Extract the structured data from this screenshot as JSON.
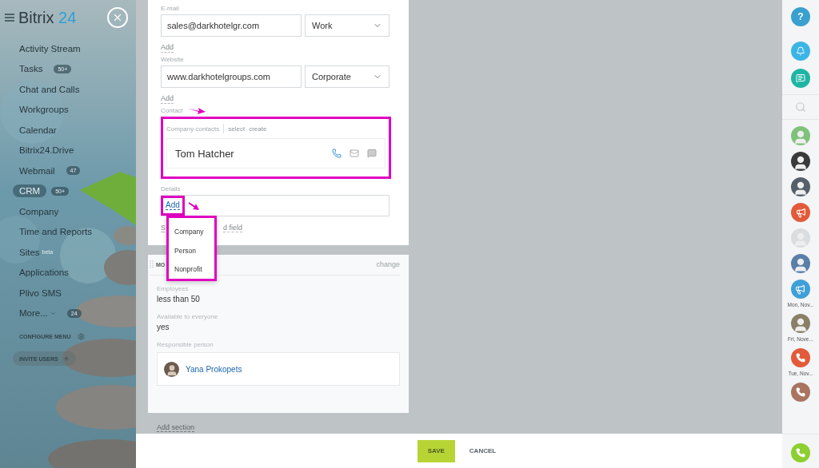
{
  "sidebar": {
    "logo": {
      "name": "Bitrix",
      "number": "24"
    },
    "items": [
      {
        "label": "Activity Stream",
        "selected": false
      },
      {
        "label": "Tasks",
        "badge": "50+",
        "selected": false
      },
      {
        "label": "Chat and Calls",
        "selected": false
      },
      {
        "label": "Workgroups",
        "selected": false
      },
      {
        "label": "Calendar",
        "selected": false
      },
      {
        "label": "Bitrix24.Drive",
        "selected": false
      },
      {
        "label": "Webmail",
        "badge": "47",
        "selected": false
      },
      {
        "label": "CRM",
        "badge": "50+",
        "selected": true
      },
      {
        "label": "Company",
        "selected": false
      },
      {
        "label": "Time and Reports",
        "selected": false
      },
      {
        "label": "Sites",
        "superscript": "beta",
        "selected": false
      },
      {
        "label": "Applications",
        "selected": false
      },
      {
        "label": "Plivo SMS",
        "selected": false
      },
      {
        "label": "More...",
        "badge": "24",
        "dropdown": true,
        "selected": false
      }
    ],
    "configure_menu": "CONFIGURE MENU",
    "invite_users": "INVITE USERS"
  },
  "form": {
    "email": {
      "label": "E-mail",
      "value": "sales@darkhotelgr.com",
      "type": "Work",
      "add": "Add"
    },
    "website": {
      "label": "Website",
      "value": "www.darkhotelgroups.com",
      "type": "Corporate",
      "add": "Add"
    },
    "contact": {
      "label": "Contact",
      "header": "Company contacts",
      "actions": [
        "select",
        "create"
      ],
      "name": "Tom Hatcher"
    },
    "details": {
      "label": "Details",
      "add": "Add",
      "field_link_start": "S",
      "field_link_end": "d field",
      "menu": [
        "Company",
        "Person",
        "Nonprofit"
      ]
    }
  },
  "section": {
    "title": "MO",
    "change": "change",
    "fields": [
      {
        "label": "Employees",
        "value": "less than 50"
      },
      {
        "label": "Available to everyone",
        "value": "yes"
      }
    ],
    "responsible": {
      "label": "Responsible person",
      "name": "Yana Prokopets"
    }
  },
  "add_section": "Add section",
  "buttons": {
    "save": "SAVE",
    "cancel": "CANCEL"
  },
  "right_bar": {
    "help": "?",
    "items": [
      {
        "kind": "bell",
        "color": "#3bb5e6"
      },
      {
        "kind": "chat",
        "color": "#1fb5a5"
      },
      {
        "kind": "search"
      },
      {
        "kind": "avatar",
        "color": "#7fc27a"
      },
      {
        "kind": "avatar",
        "color": "#3a3a3a"
      },
      {
        "kind": "avatar",
        "color": "#55606a"
      },
      {
        "kind": "megaphone",
        "color": "#e35a3a"
      },
      {
        "kind": "avatar",
        "color": "#d9dde0"
      },
      {
        "kind": "avatar",
        "color": "#5a7fa8"
      },
      {
        "kind": "megaphone",
        "color": "#3f9fd8",
        "caption": "Mon, Nov..."
      },
      {
        "kind": "avatar",
        "color": "#8a8068",
        "caption": "Fri, Nove..."
      },
      {
        "kind": "phone",
        "color": "#e35a3a",
        "caption": "Tue, Nov..."
      },
      {
        "kind": "phone",
        "color": "#a97560"
      }
    ],
    "call": {
      "color": "#8ccf2f"
    }
  }
}
